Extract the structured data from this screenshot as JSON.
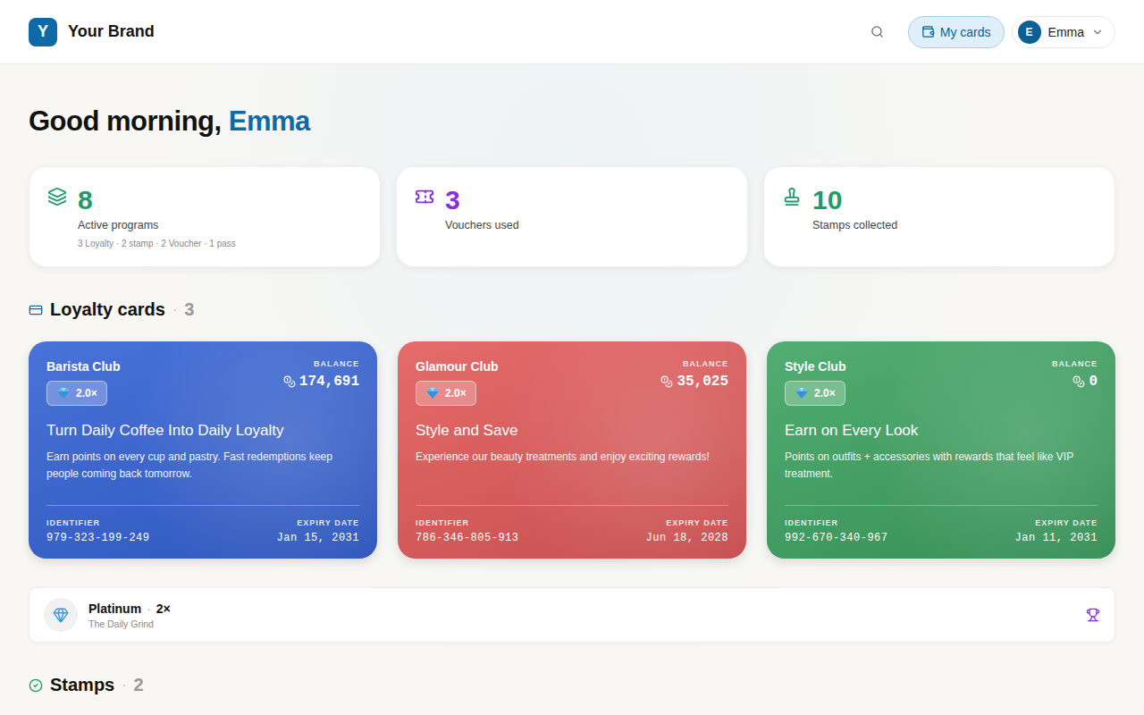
{
  "brand": {
    "logo_letter": "Y",
    "name": "Your Brand"
  },
  "header": {
    "my_cards": {
      "label": "My cards",
      "selected": true
    },
    "user": {
      "initial": "E",
      "name": "Emma"
    }
  },
  "greeting": {
    "text": "Good morning,",
    "name": "Emma"
  },
  "stats": [
    {
      "value": "8",
      "label": "Active programs",
      "detail": "3 Loyalty · 2 stamp · 2 Voucher · 1 pass",
      "color": "#1f9a6a"
    },
    {
      "value": "3",
      "label": "Vouchers used",
      "detail": "",
      "color": "#8b2fd9"
    },
    {
      "value": "10",
      "label": "Stamps collected",
      "detail": "",
      "color": "#1f9a6a"
    }
  ],
  "loyalty": {
    "title": "Loyalty cards",
    "separator": "·",
    "count": "3",
    "cards": [
      {
        "name": "Barista Club",
        "tier": "2.0×",
        "balance_label": "BALANCE",
        "balance": "174,691",
        "headline": "Turn Daily Coffee Into Daily Loyalty",
        "description": "Earn points on every cup and pastry. Fast redemptions keep people coming back tomorrow.",
        "identifier_label": "IDENTIFIER",
        "identifier": "979-323-199-249",
        "expiry_label": "EXPIRY DATE",
        "expiry": "Jan 15, 2031",
        "color": "#3563d6"
      },
      {
        "name": "Glamour Club",
        "tier": "2.0×",
        "balance_label": "BALANCE",
        "balance": "35,025",
        "headline": "Style and Save",
        "description": "Experience our beauty treatments and enjoy exciting rewards!",
        "identifier_label": "IDENTIFIER",
        "identifier": "786-346-805-913",
        "expiry_label": "EXPIRY DATE",
        "expiry": "Jun 18, 2028",
        "color": "#e35a5a"
      },
      {
        "name": "Style Club",
        "tier": "2.0×",
        "balance_label": "BALANCE",
        "balance": "0",
        "headline": "Earn on Every Look",
        "description": "Points on outfits + accessories with rewards that feel like VIP treatment.",
        "identifier_label": "IDENTIFIER",
        "identifier": "992-670-340-967",
        "expiry_label": "EXPIRY DATE",
        "expiry": "Jan 11, 2031",
        "color": "#3ea462"
      }
    ]
  },
  "tier_row": {
    "name": "Platinum",
    "separator": "·",
    "multiplier": "2×",
    "program": "The Daily Grind"
  },
  "stamps": {
    "title": "Stamps",
    "separator": "·",
    "count": "2"
  }
}
